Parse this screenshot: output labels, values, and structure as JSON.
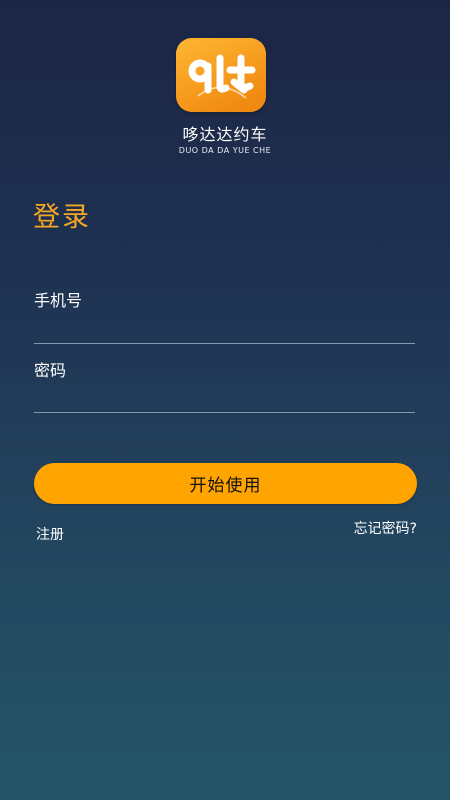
{
  "app": {
    "name": "哆达达约车",
    "subtitle": "DUO DA DA YUE CHE",
    "logo_icon": "qdt-logo-icon"
  },
  "login": {
    "title": "登录",
    "phone_label": "手机号",
    "phone_value": "",
    "password_label": "密码",
    "password_value": "",
    "submit_label": "开始使用",
    "register_label": "注册",
    "forgot_label": "忘记密码?"
  },
  "colors": {
    "accent": "#f5a623",
    "button": "#ffa400",
    "background_top": "#1c2545",
    "background_bottom": "#245468"
  }
}
